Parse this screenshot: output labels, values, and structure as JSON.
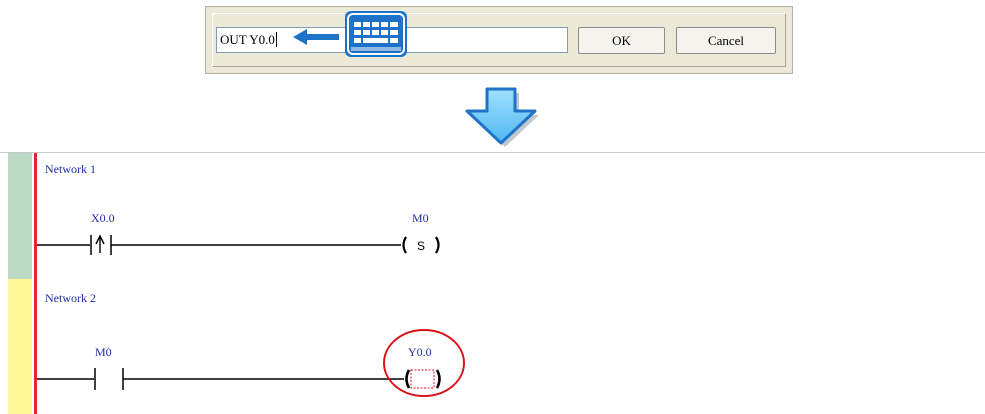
{
  "dialog": {
    "input_value": "OUT Y0.0",
    "ok_label": "OK",
    "cancel_label": "Cancel"
  },
  "icons": {
    "arrow": "arrow-left-icon",
    "keyboard": "keyboard-icon",
    "down": "down-arrow-icon"
  },
  "ladder": {
    "networks": [
      {
        "label": "Network 1",
        "contact_label": "X0.0",
        "contact_type": "rising-edge",
        "coil_label": "M0",
        "coil_symbol": "S"
      },
      {
        "label": "Network 2",
        "contact_label": "M0",
        "contact_type": "normally-open",
        "coil_label": "Y0.0",
        "coil_symbol": ""
      }
    ]
  },
  "colors": {
    "rail": "#e3262b",
    "label": "#1d2ea8",
    "network1_gutter": "#bcd9c3",
    "network2_gutter": "#fff697",
    "highlight": "#d9141b",
    "accent_blue": "#1e73c8"
  }
}
